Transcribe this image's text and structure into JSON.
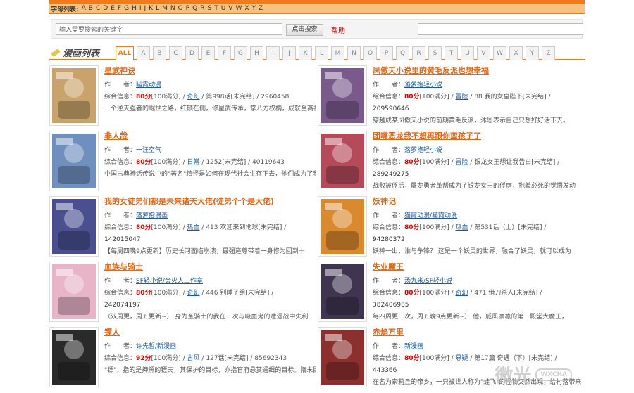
{
  "alpha_bar": {
    "label": "字母列表:",
    "letters": [
      "A",
      "B",
      "C",
      "D",
      "E",
      "F",
      "G",
      "H",
      "I",
      "J",
      "K",
      "L",
      "M",
      "N",
      "O",
      "P",
      "Q",
      "R",
      "S",
      "T",
      "U",
      "V",
      "W",
      "X",
      "Y",
      "Z"
    ]
  },
  "search": {
    "placeholder": "输入需要搜索的关键字",
    "button_label": "点击搜索",
    "help_label": "帮助"
  },
  "list": {
    "title": "漫画列表",
    "tabs": [
      "ALL",
      "A",
      "B",
      "C",
      "D",
      "E",
      "F",
      "G",
      "H",
      "I",
      "J",
      "K",
      "L",
      "M",
      "N",
      "O",
      "P",
      "Q",
      "R",
      "S",
      "T",
      "U",
      "V",
      "W",
      "X",
      "Y",
      "Z"
    ]
  },
  "labels": {
    "author": "作　　者：",
    "info": "综合信息：",
    "score_suffix": "[100满分] /"
  },
  "comics": [
    {
      "title": "星武神诀",
      "author": "猫霓动漫",
      "score": "80分",
      "genre": "奇幻",
      "rest": "/ 第998话[未完结] / 2960458",
      "extra": "",
      "desc": "一个逆天强者的崛世之路，红颜在侧，修星武传承，掌八方权柄，成就至高神王！温柔可爱的天才少女，火辣奔放的郡主,神秘的妖族美女迁有传",
      "cover": "#c9a36b"
    },
    {
      "title": "凤傲天小说里的黄毛反派也想幸福",
      "author": "落萝抱轻小说",
      "score": "80分",
      "genre": "冒险",
      "rest": "/ 88 我的女皇陛下[未完结] /",
      "extra": "209590646",
      "desc": "穿越成某凤傲天小说的前期黄毛反派，沐恩表示自己只想好好活下去。",
      "cover": "#7a5a8c"
    },
    {
      "title": "非人哉",
      "author": "一汪空气",
      "score": "80分",
      "genre": "日常",
      "rest": "/ 1252[未完结] / 40119643",
      "extra": "",
      "desc": "中国古典神话传说中的\"著名\"精怪是如何在现代社会生存下去，他们成为了我们身边有着神仙特色的宅女、暖男、上班族，犬系男友，他们上演着",
      "cover": "#6f8fbf"
    },
    {
      "title": "团嘴恶龙我不想再跟你蛮孩子了",
      "author": "落萝抱轻小说",
      "score": "80分",
      "genre": "冒险",
      "rest": "/ 银龙女王想让我告白[未完结] /",
      "extra": "289249275",
      "desc": "战败被俘后，屠龙勇者革帮成为了银龙女王的俘虏，抱着必死的觉悟发动",
      "cover": "#b54a5a"
    },
    {
      "title": "我的女徒弟们都是未来诸天大佬(徒弟个个是大佬)",
      "author": "落萝抱漫画",
      "score": "80分",
      "genre": "热血",
      "rest": "/ 413 欢迎来到地球[未完结] /",
      "extra": "142015047",
      "desc": "【每周四晚9点更新】历史长河面临崩溃，最强道尊带着一身修为回到十",
      "cover": "#4a4f8f"
    },
    {
      "title": "妖神记",
      "author": "猫霓动漫/猫霓动漫",
      "score": "80分",
      "genre": "热血",
      "rest": "/ 第531话（上）[未完结] /",
      "extra": "94280372",
      "desc": "妖神一出，谁与争锋？ 这是一个妖灵的世界，融合了妖灵，就可以成为",
      "cover": "#d9892e"
    },
    {
      "title": "血族与骑士",
      "author": "SF轻小说/会火人工作室",
      "score": "80分",
      "genre": "奇幻",
      "rest": "/ 446 别睡了组[未完结] /",
      "extra": "242074197",
      "desc": "（双周更，周五更新~） 身为圣骑士的我在一次与吸血鬼的遭遇战中失利",
      "cover": "#e7b4c8"
    },
    {
      "title": "失业魔王",
      "author": "汤九米/SF轻小说",
      "score": "80分",
      "genre": "奇幻",
      "rest": "/ 471 借刀杀人[未完结] /",
      "extra": "382406985",
      "desc": "每四周更一次，周五晚9点更新~） 他，戚风凛凛的第一殿堂大魔王，",
      "cover": "#3f3550"
    },
    {
      "title": "镖人",
      "author": "许先哲/新漫画",
      "score": "92分",
      "genre": "古风",
      "rest": "/ 127话[未完结] / 85692343",
      "extra": "",
      "desc": "\"镖\"，指的是押解的镖夫，其保护的目标，亦指官府悬赏通缉的目标。隋末民乱四方，江湖上掀起了一阵腥风血雨，各路人马的恩怨情仇逐渐展",
      "cover": "#2a2a2a"
    },
    {
      "title": "赤焰万里",
      "author": "新漫画",
      "score": "80分",
      "genre": "悬疑",
      "rest": "/ 第17篇 奇遇（下）[未完结] /",
      "extra": "443366",
      "desc": "在名为索莉丘的帝乡，一只被世人称为\"蛙飞\"的怪物突然出现，给村落带来",
      "cover": "#8c2f2f"
    }
  ],
  "watermark": {
    "text": "微光",
    "badge": "WXCHA"
  }
}
